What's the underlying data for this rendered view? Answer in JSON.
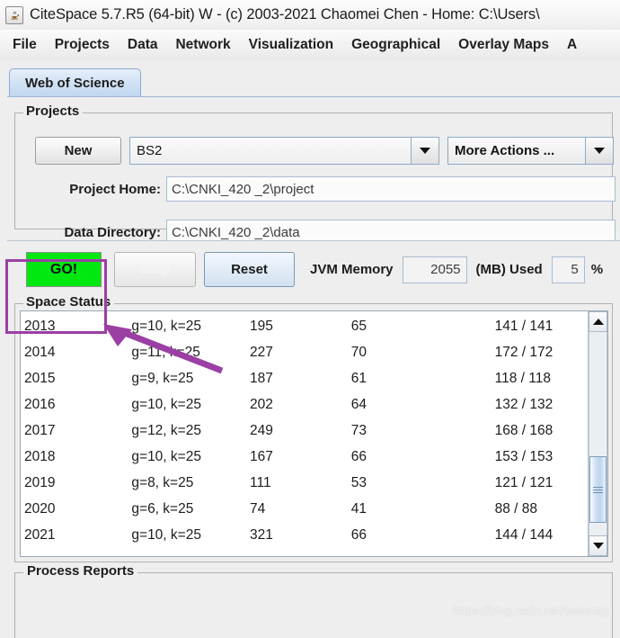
{
  "window": {
    "icon": "java-coffee-cup-icon",
    "title": "CiteSpace 5.7.R5 (64-bit) W - (c) 2003-2021 Chaomei Chen - Home: C:\\Users\\"
  },
  "menubar": {
    "items": [
      {
        "label": "File",
        "name": "menu-file"
      },
      {
        "label": "Projects",
        "name": "menu-projects"
      },
      {
        "label": "Data",
        "name": "menu-data"
      },
      {
        "label": "Network",
        "name": "menu-network"
      },
      {
        "label": "Visualization",
        "name": "menu-visualization"
      },
      {
        "label": "Geographical",
        "name": "menu-geographical"
      },
      {
        "label": "Overlay Maps",
        "name": "menu-overlay-maps"
      },
      {
        "label": "A",
        "name": "menu-analytics-partial"
      }
    ]
  },
  "tabs": [
    {
      "label": "Web of Science",
      "name": "tab-web-of-science",
      "selected": true
    }
  ],
  "projects": {
    "group_title": "Projects",
    "new_label": "New",
    "project_value": "BS2",
    "more_actions_label": "More Actions ...",
    "project_home_label": "Project Home:",
    "project_home_value": "C:\\CNKI_420 _2\\project",
    "data_directory_label": "Data Directory:",
    "data_directory_value": "C:\\CNKI_420 _2\\data"
  },
  "actionbar": {
    "go_label": "GO!",
    "stop_label": "Stop",
    "reset_label": "Reset",
    "jvm_memory_label": "JVM Memory",
    "jvm_memory_value": "2055",
    "mb_used_label": "(MB) Used",
    "jvm_percent_value": "5",
    "percent_sign": "%"
  },
  "space_status": {
    "group_title": "Space Status",
    "rows": [
      {
        "year": "2013",
        "gk": "g=10, k=25",
        "n1": "195",
        "n2": "65",
        "ratio": "141 / 141"
      },
      {
        "year": "2014",
        "gk": "g=11, k=25",
        "n1": "227",
        "n2": "70",
        "ratio": "172 / 172"
      },
      {
        "year": "2015",
        "gk": "g=9, k=25",
        "n1": "187",
        "n2": "61",
        "ratio": "118 / 118"
      },
      {
        "year": "2016",
        "gk": "g=10, k=25",
        "n1": "202",
        "n2": "64",
        "ratio": "132 / 132"
      },
      {
        "year": "2017",
        "gk": "g=12, k=25",
        "n1": "249",
        "n2": "73",
        "ratio": "168 / 168"
      },
      {
        "year": "2018",
        "gk": "g=10, k=25",
        "n1": "167",
        "n2": "66",
        "ratio": "153 / 153"
      },
      {
        "year": "2019",
        "gk": "g=8, k=25",
        "n1": "111",
        "n2": "53",
        "ratio": "121 / 121"
      },
      {
        "year": "2020",
        "gk": "g=6, k=25",
        "n1": "74",
        "n2": "41",
        "ratio": "88 / 88"
      },
      {
        "year": "2021",
        "gk": "g=10, k=25",
        "n1": "321",
        "n2": "66",
        "ratio": "144 / 144"
      }
    ]
  },
  "bottom_group": {
    "group_title": "Process Reports"
  },
  "annotation": {
    "color": "#9b3fa5",
    "target": "go-button"
  },
  "watermark": {
    "text": "https://blog.csdn.net/sweetqp"
  }
}
